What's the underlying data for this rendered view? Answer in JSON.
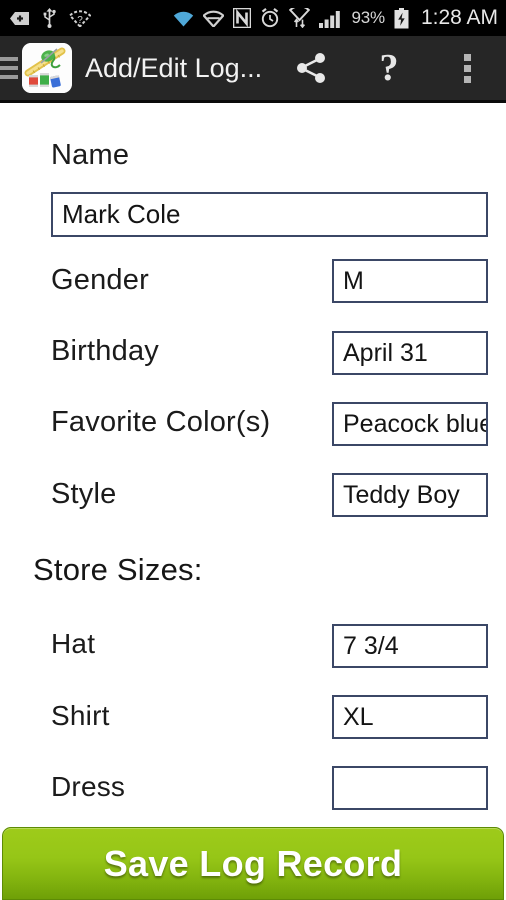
{
  "status_bar": {
    "icons": [
      "back-sd-icon",
      "usb-icon",
      "wifi-question-icon",
      "wifi-icon",
      "vpn-shield-icon",
      "nfc-icon",
      "alarm-icon",
      "wifi-transfer-icon",
      "cell-signal-icon"
    ],
    "battery_percent": "93%",
    "battery_icon": "battery-charging-icon",
    "time": "1:28 AM"
  },
  "action_bar": {
    "menu_icon": "hamburger-menu-icon",
    "app_icon": "sewing-kit-icon",
    "title": "Add/Edit Log...",
    "share_icon": "share-icon",
    "help_label": "?",
    "overflow_icon": "overflow-menu-icon"
  },
  "form": {
    "name": {
      "label": "Name",
      "value": "Mark Cole",
      "placeholder": ""
    },
    "fields": [
      {
        "label": "Gender",
        "value": "M",
        "placeholder": ""
      },
      {
        "label": "Birthday",
        "value": "April 31",
        "placeholder": ""
      },
      {
        "label": "Favorite Color(s)",
        "value": "Peacock blue",
        "placeholder": ""
      },
      {
        "label": "Style",
        "value": "Teddy Boy",
        "placeholder": ""
      }
    ],
    "section": {
      "title": "Store Sizes:"
    },
    "sizes": [
      {
        "label": "Hat",
        "value": "7 3/4",
        "placeholder": ""
      },
      {
        "label": "Shirt",
        "value": "XL",
        "placeholder": ""
      },
      {
        "label": "Dress",
        "value": "",
        "placeholder": ""
      }
    ]
  },
  "footer": {
    "save_label": "Save Log Record",
    "save_color_top": "#9ecb1a",
    "save_color_bottom": "#6fa007"
  }
}
